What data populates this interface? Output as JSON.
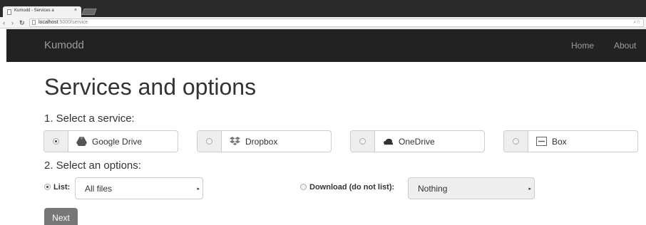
{
  "browser": {
    "tab_title": "Kumodd - Services a",
    "tab_close": "×",
    "url_host": "localhost",
    "url_path": ":5000/service"
  },
  "navbar": {
    "brand": "Kumodd",
    "links": [
      "Home",
      "About"
    ]
  },
  "page": {
    "title": "Services and options",
    "step1": "1. Select a service:",
    "step2": "2. Select an options:"
  },
  "services": [
    {
      "name": "Google Drive",
      "icon": "google-drive-icon",
      "selected": true
    },
    {
      "name": "Dropbox",
      "icon": "dropbox-icon",
      "selected": false
    },
    {
      "name": "OneDrive",
      "icon": "onedrive-icon",
      "selected": false
    },
    {
      "name": "Box",
      "icon": "box-icon",
      "selected": false
    }
  ],
  "options": {
    "list_label": "List:",
    "list_value": "All files",
    "list_selected": true,
    "download_label": "Download (do not list):",
    "download_value": "Nothing",
    "download_selected": false
  },
  "next_button": "Next",
  "colors": {
    "navbar_bg": "#222222",
    "navbar_text": "#9d9d9d",
    "button_bg": "#777777"
  }
}
